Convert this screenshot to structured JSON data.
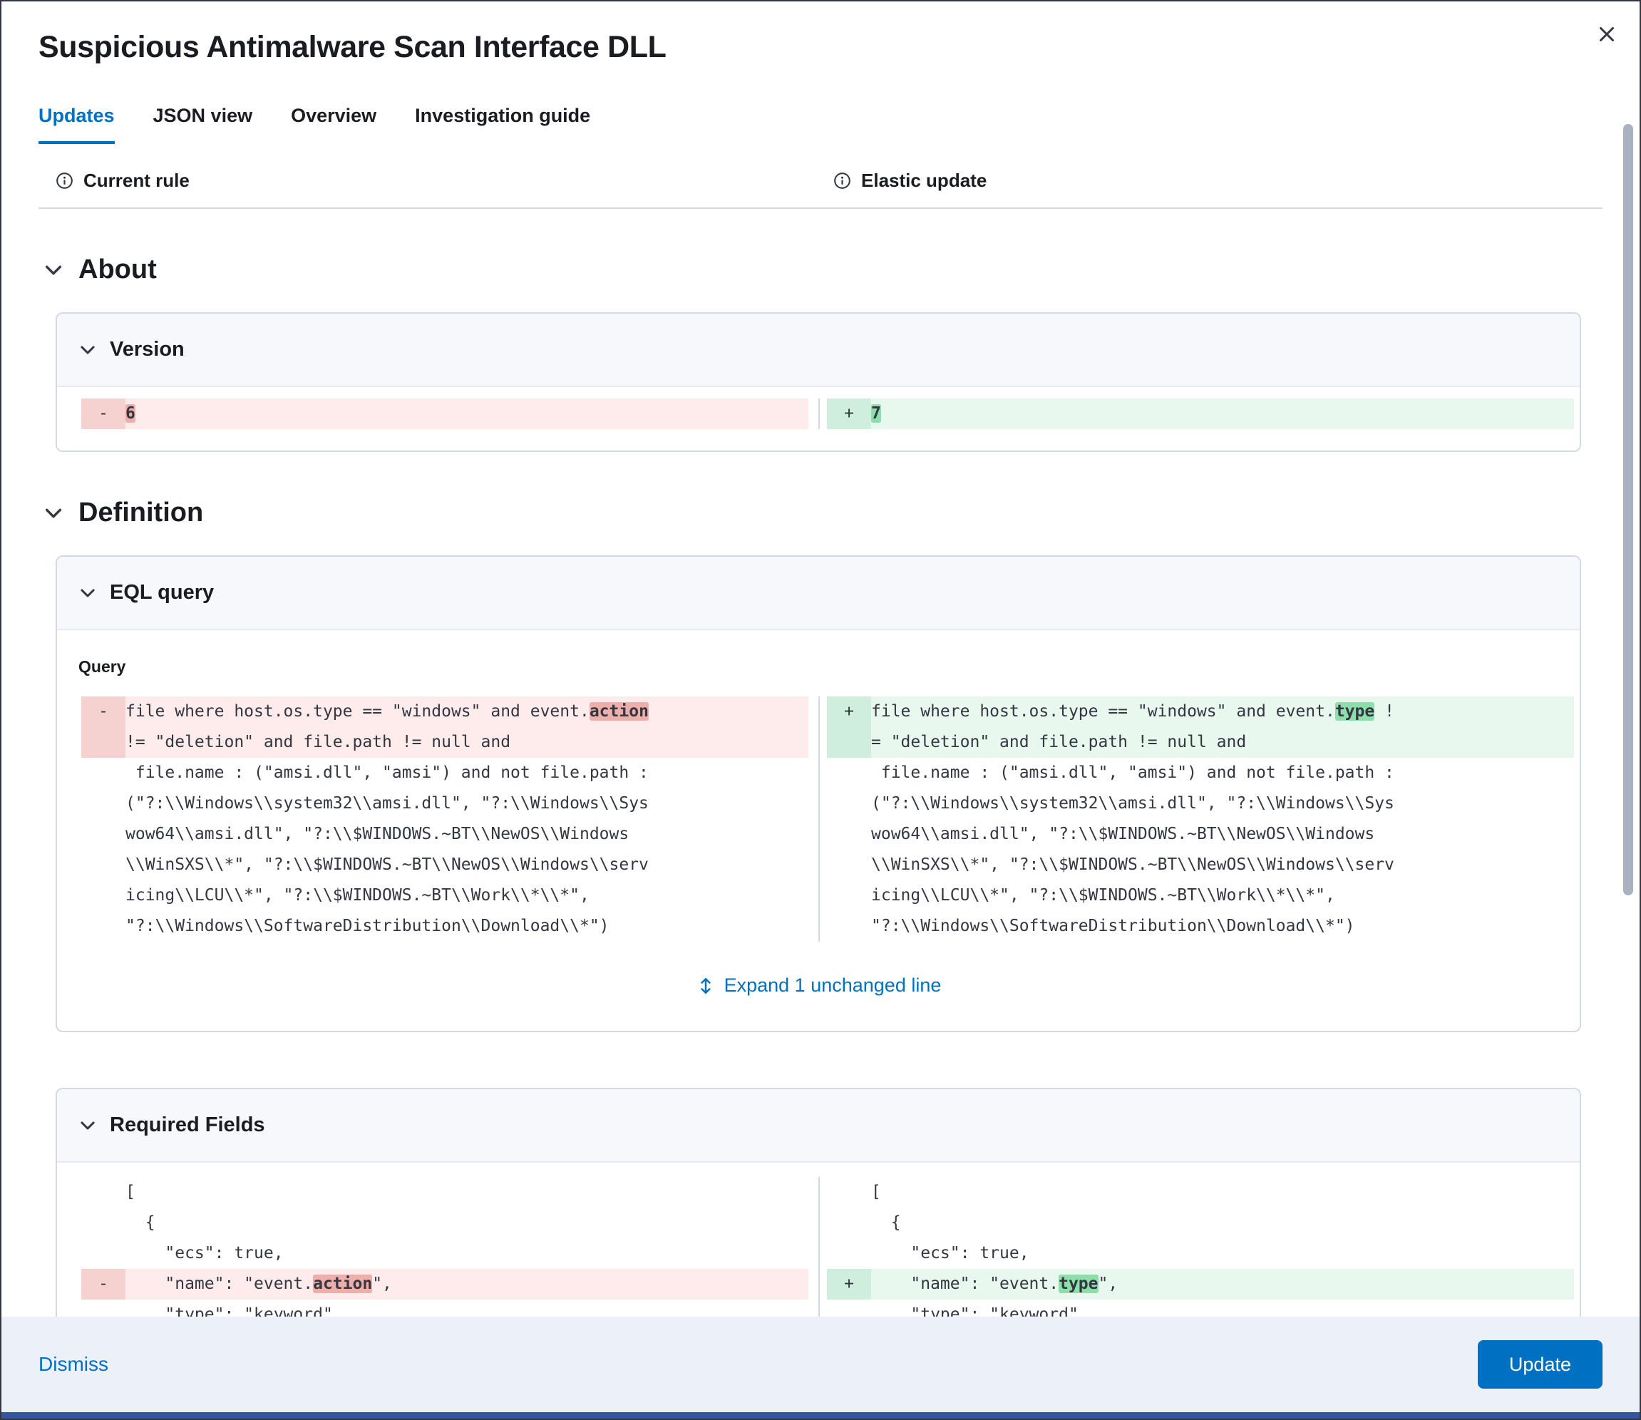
{
  "window": {
    "title": "Suspicious Antimalware Scan Interface DLL"
  },
  "tabs": {
    "updates": "Updates",
    "json_view": "JSON view",
    "overview": "Overview",
    "investigation_guide": "Investigation guide"
  },
  "diff_headers": {
    "current_rule": "Current rule",
    "elastic_update": "Elastic update"
  },
  "about": {
    "heading": "About",
    "version": {
      "heading": "Version",
      "removed_marker": "-",
      "added_marker": "+",
      "current_value": "6",
      "updated_value": "7"
    }
  },
  "definition": {
    "heading": "Definition",
    "eql_query": {
      "heading": "EQL query",
      "query_label": "Query",
      "removed_marker": "-",
      "added_marker": "+",
      "current": {
        "line1_pre": "file where host.os.type == \"windows\" and event.",
        "line1_highlight": "action",
        "line1_post": "",
        "line2": "!= \"deletion\" and file.path != null and"
      },
      "update": {
        "line1_pre": "file where host.os.type == \"windows\" and event.",
        "line1_highlight": "type",
        "line1_post": " !",
        "line2": "= \"deletion\" and file.path != null and"
      },
      "unchanged_lines": [
        " file.name : (\"amsi.dll\", \"amsi\") and not file.path :",
        "(\"?:\\\\Windows\\\\system32\\\\amsi.dll\", \"?:\\\\Windows\\\\Sys",
        "wow64\\\\amsi.dll\", \"?:\\\\$WINDOWS.~BT\\\\NewOS\\\\Windows",
        "\\\\WinSXS\\\\*\", \"?:\\\\$WINDOWS.~BT\\\\NewOS\\\\Windows\\\\serv",
        "icing\\\\LCU\\\\*\", \"?:\\\\$WINDOWS.~BT\\\\Work\\\\*\\\\*\",",
        "\"?:\\\\Windows\\\\SoftwareDistribution\\\\Download\\\\*\")"
      ],
      "expand_link": "Expand 1 unchanged line"
    },
    "required_fields": {
      "heading": "Required Fields",
      "removed_marker": "-",
      "added_marker": "+",
      "context_before": [
        "[",
        "  {",
        "    \"ecs\": true,"
      ],
      "current_changed": {
        "pre": "    \"name\": \"event.",
        "highlight": "action",
        "post": "\","
      },
      "update_changed": {
        "pre": "    \"name\": \"event.",
        "highlight": "type",
        "post": "\","
      },
      "context_after": [
        "    \"type\": \"keyword\""
      ]
    }
  },
  "footer": {
    "dismiss": "Dismiss",
    "update": "Update"
  }
}
